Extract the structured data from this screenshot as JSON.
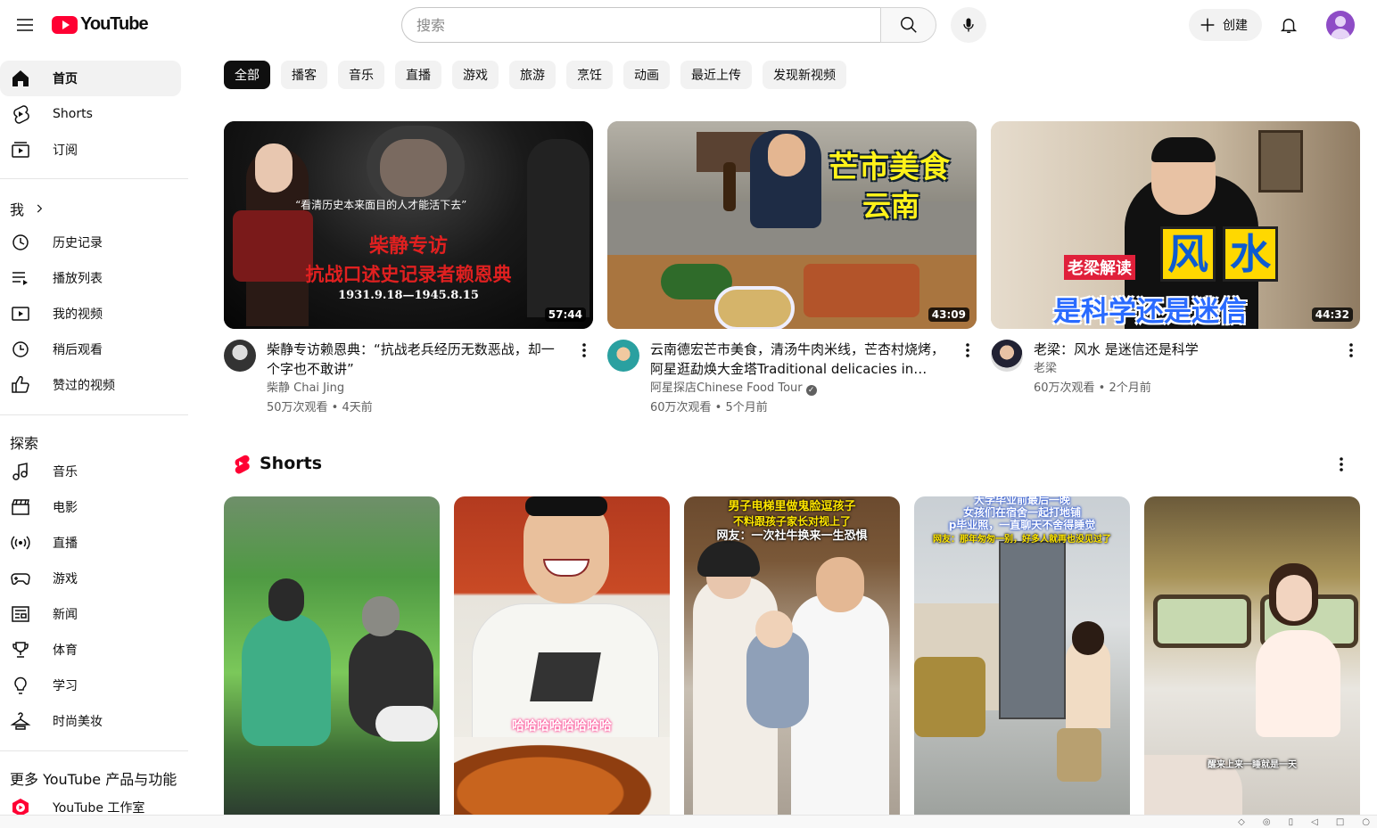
{
  "header": {
    "logo_text": "YouTube",
    "search_placeholder": "搜索",
    "create_label": "创建"
  },
  "sidebar": {
    "primary": [
      {
        "label": "首页",
        "icon": "home-icon",
        "active": true
      },
      {
        "label": "Shorts",
        "icon": "shorts-icon"
      },
      {
        "label": "订阅",
        "icon": "subscriptions-icon"
      }
    ],
    "you_heading": "我",
    "you": [
      {
        "label": "历史记录",
        "icon": "history-icon"
      },
      {
        "label": "播放列表",
        "icon": "playlist-icon"
      },
      {
        "label": "我的视频",
        "icon": "your-videos-icon"
      },
      {
        "label": "稍后观看",
        "icon": "watch-later-icon"
      },
      {
        "label": "赞过的视频",
        "icon": "liked-icon"
      }
    ],
    "explore_heading": "探索",
    "explore": [
      {
        "label": "音乐",
        "icon": "music-icon"
      },
      {
        "label": "电影",
        "icon": "movies-icon"
      },
      {
        "label": "直播",
        "icon": "live-icon"
      },
      {
        "label": "游戏",
        "icon": "gaming-icon"
      },
      {
        "label": "新闻",
        "icon": "news-icon"
      },
      {
        "label": "体育",
        "icon": "sports-icon"
      },
      {
        "label": "学习",
        "icon": "learning-icon"
      },
      {
        "label": "时尚美妆",
        "icon": "fashion-icon"
      }
    ],
    "more_heading": "更多 YouTube 产品与功能",
    "more": [
      {
        "label": "YouTube 工作室",
        "icon": "studio-icon"
      }
    ]
  },
  "chips": [
    "全部",
    "播客",
    "音乐",
    "直播",
    "游戏",
    "旅游",
    "烹饪",
    "动画",
    "最近上传",
    "发现新视频"
  ],
  "videos": [
    {
      "title": "柴静专访赖恩典：“抗战老兵经历无数恶战，却一个字也不敢讲”",
      "channel": "柴静 Chai Jing",
      "stats": "50万次观看 • 4天前",
      "duration": "57:44",
      "thumb_quote": "“看清历史本来面目的人才能活下去”",
      "thumb_title1": "柴静专访",
      "thumb_title2": "抗战口述史记录者赖恩典",
      "thumb_dates": "1931.9.18—1945.8.15"
    },
    {
      "title": "云南德宏芒市美食，清汤牛肉米线，芒杏村烧烤，阿星逛勐焕大金塔Traditional delicacies in Yunnan",
      "channel": "阿星探店Chinese Food Tour",
      "verified": true,
      "stats": "60万次观看 • 5个月前",
      "duration": "43:09",
      "thumb_title1": "芒市美食",
      "thumb_title2": "云南"
    },
    {
      "title": "老梁：风水 是迷信还是科学",
      "channel": "老梁",
      "stats": "60万次观看 • 2个月前",
      "duration": "44:32",
      "thumb_badge": "老梁解读",
      "thumb_big1": "风",
      "thumb_big2": "水",
      "thumb_sub": "是科学还是迷信"
    }
  ],
  "shorts": {
    "title": "Shorts",
    "items": [
      {
        "caption_top": "",
        "caption_bottom": ""
      },
      {
        "caption_top": "",
        "caption_bottom": "哈哈哈哈哈哈哈哈"
      },
      {
        "caption_top": "男子电梯里做鬼脸逗孩子",
        "caption_line2": "不料跟孩子家长对视上了",
        "caption_line3": "网友：一次社牛换来一生恐惧",
        "caption_bottom": ""
      },
      {
        "caption_top": "大学毕业前最后一晚",
        "caption_line2": "女孩们在宿舍一起打地铺",
        "caption_line3": "p毕业照，一直聊天不舍得睡觉",
        "caption_line4": "网友：那年匆匆一别，好多人就再也没见过了",
        "caption_bottom": ""
      },
      {
        "caption_top": "",
        "caption_bottom": "醒来上来一睡就是一天"
      }
    ]
  },
  "colors": {
    "brand_red": "#ff0033",
    "chip_active_bg": "#0f0f0f",
    "chip_bg": "#f2f2f2",
    "secondary_text": "#606060"
  }
}
